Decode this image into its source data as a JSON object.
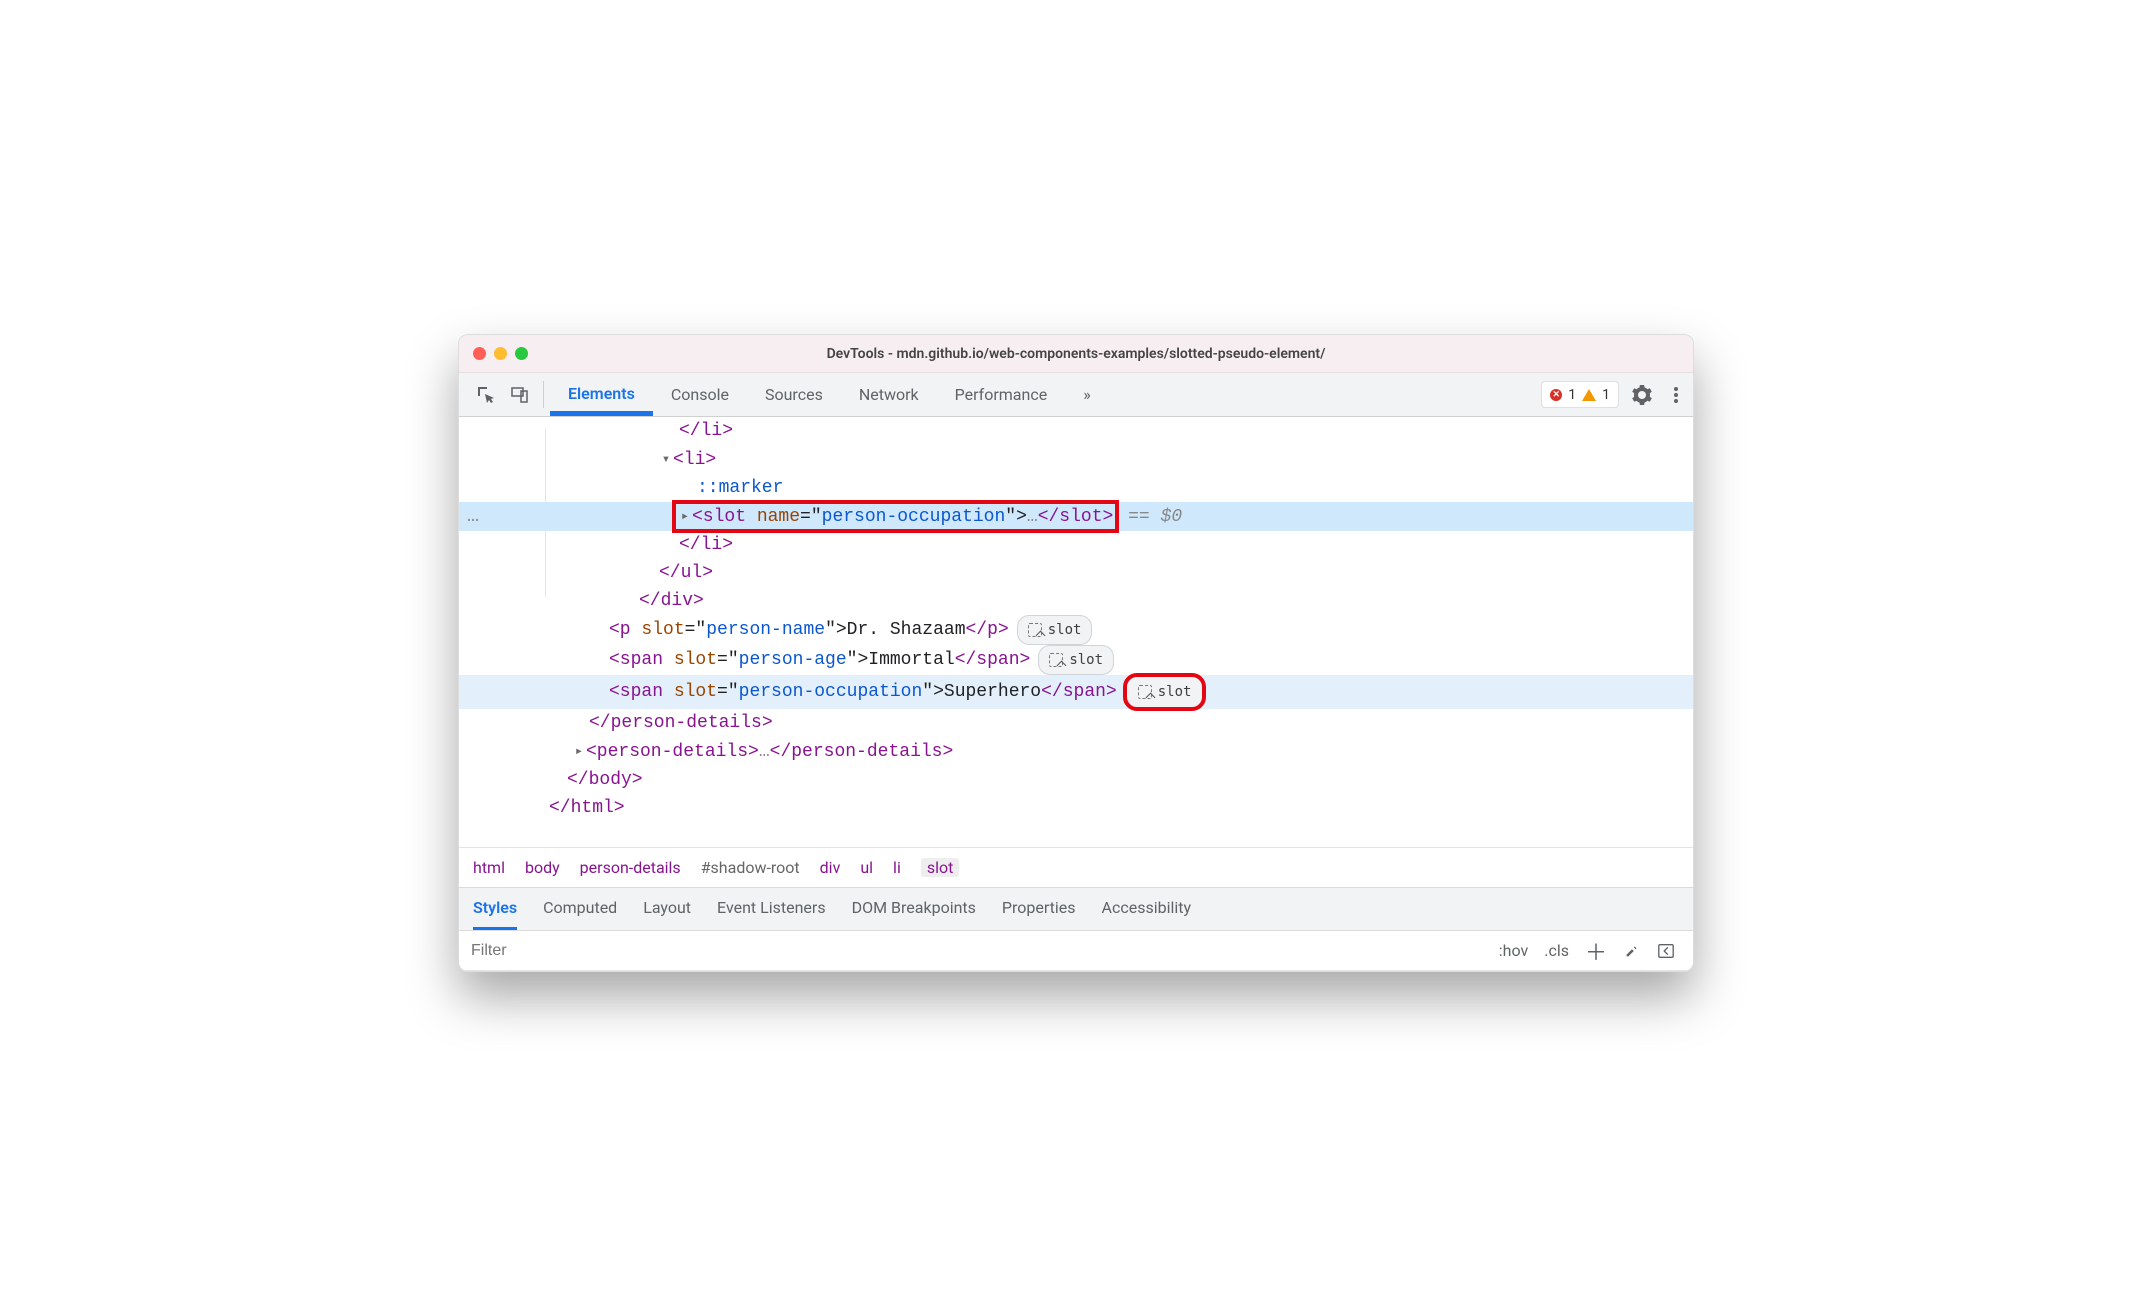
{
  "window": {
    "title": "DevTools - mdn.github.io/web-components-examples/slotted-pseudo-element/"
  },
  "toolbar": {
    "tabs": [
      "Elements",
      "Console",
      "Sources",
      "Network",
      "Performance"
    ],
    "active": 0,
    "more": "»",
    "errors": "1",
    "warnings": "1"
  },
  "tree": {
    "close_li": "</li>",
    "open_li": "<li>",
    "marker": "::marker",
    "slot_open_a": "<slot",
    "slot_attr_name": " name",
    "slot_attr_eq": "=\"",
    "slot_attr_val": "person-occupation",
    "slot_attr_q": "\">",
    "slot_mid": "…",
    "slot_close": "</slot>",
    "eq0": " == $0",
    "close_li2": "</li>",
    "close_ul": "</ul>",
    "close_div": "</div>",
    "p_open": "<p",
    "p_slot": " slot",
    "p_eq": "=\"",
    "p_val": "person-name",
    "p_q": "\">",
    "p_txt": "Dr. Shazaam",
    "p_close": "</p>",
    "s1_open": "<span",
    "s1_slot": " slot",
    "s1_eq": "=\"",
    "s1_val": "person-age",
    "s1_q": "\">",
    "s1_txt": "Immortal",
    "s1_close": "</span>",
    "s2_open": "<span",
    "s2_slot": " slot",
    "s2_eq": "=\"",
    "s2_val": "person-occupation",
    "s2_q": "\">",
    "s2_txt": "Superhero",
    "s2_close": "</span>",
    "close_pd": "</person-details>",
    "pd2_open": "<person-details>",
    "pd2_mid": "…",
    "pd2_close": "</person-details>",
    "close_body": "</body>",
    "close_html": "</html>",
    "pill": "slot"
  },
  "breadcrumb": [
    "html",
    "body",
    "person-details",
    "#shadow-root",
    "div",
    "ul",
    "li",
    "slot"
  ],
  "stylesTabs": [
    "Styles",
    "Computed",
    "Layout",
    "Event Listeners",
    "DOM Breakpoints",
    "Properties",
    "Accessibility"
  ],
  "filter": {
    "placeholder": "Filter",
    "hov": ":hov",
    "cls": ".cls"
  }
}
